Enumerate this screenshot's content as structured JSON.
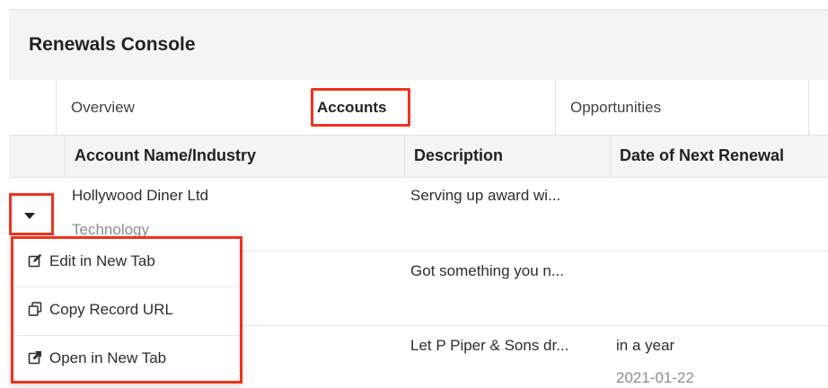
{
  "header": {
    "title": "Renewals Console"
  },
  "tabs": [
    {
      "label": "Overview"
    },
    {
      "label": "Accounts"
    },
    {
      "label": "Opportunities"
    }
  ],
  "table": {
    "columns": [
      "Account Name/Industry",
      "Description",
      "Date of Next Renewal"
    ],
    "rows": [
      {
        "name": "Hollywood Diner Ltd",
        "industry": "Technology",
        "description": "Serving up award wi...",
        "renewal": "",
        "renewal_date": ""
      },
      {
        "name": "",
        "industry": "",
        "description": "Got something you n...",
        "renewal": "",
        "renewal_date": ""
      },
      {
        "name": "",
        "industry": "",
        "description": "Let P Piper & Sons dr...",
        "renewal": "in a year",
        "renewal_date": "2021-01-22"
      }
    ]
  },
  "row_actions_menu": {
    "items": [
      {
        "label": "Edit in New Tab",
        "icon": "edit-icon"
      },
      {
        "label": "Copy Record URL",
        "icon": "copy-icon"
      },
      {
        "label": "Open in New Tab",
        "icon": "external-link-icon"
      }
    ]
  },
  "colors": {
    "highlight": "#f0321d"
  }
}
